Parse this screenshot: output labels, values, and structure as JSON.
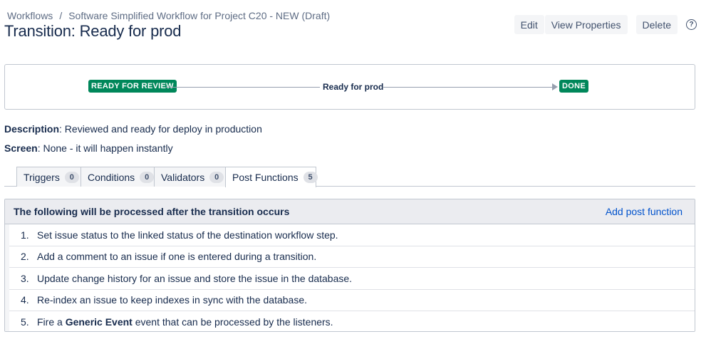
{
  "breadcrumb": {
    "root": "Workflows",
    "separator": "/",
    "current": "Software Simplified Workflow for Project C20 - NEW (Draft)"
  },
  "page": {
    "title": "Transition: Ready for prod"
  },
  "actions": {
    "edit": "Edit",
    "view_properties": "View Properties",
    "delete": "Delete",
    "help_icon": "?"
  },
  "diagram": {
    "from_status": "READY FOR REVIEW",
    "transition": "Ready for prod",
    "to_status": "DONE",
    "status_color": "#00875a"
  },
  "meta": {
    "description_label": "Description",
    "description_value": ": Reviewed and ready for deploy in production",
    "screen_label": "Screen",
    "screen_value": ": None - it will happen instantly"
  },
  "tabs": [
    {
      "label": "Triggers",
      "count": "0"
    },
    {
      "label": "Conditions",
      "count": "0"
    },
    {
      "label": "Validators",
      "count": "0"
    },
    {
      "label": "Post Functions",
      "count": "5"
    }
  ],
  "post_functions": {
    "header": "The following will be processed after the transition occurs",
    "add_link": "Add post function",
    "items": [
      {
        "num": "1.",
        "text": "Set issue status to the linked status of the destination workflow step."
      },
      {
        "num": "2.",
        "text": "Add a comment to an issue if one is entered during a transition."
      },
      {
        "num": "3.",
        "text": "Update change history for an issue and store the issue in the database."
      },
      {
        "num": "4.",
        "text": "Re-index an issue to keep indexes in sync with the database."
      },
      {
        "num": "5.",
        "pre": "Fire a ",
        "bold": "Generic Event",
        "post": " event that can be processed by the listeners."
      }
    ]
  }
}
